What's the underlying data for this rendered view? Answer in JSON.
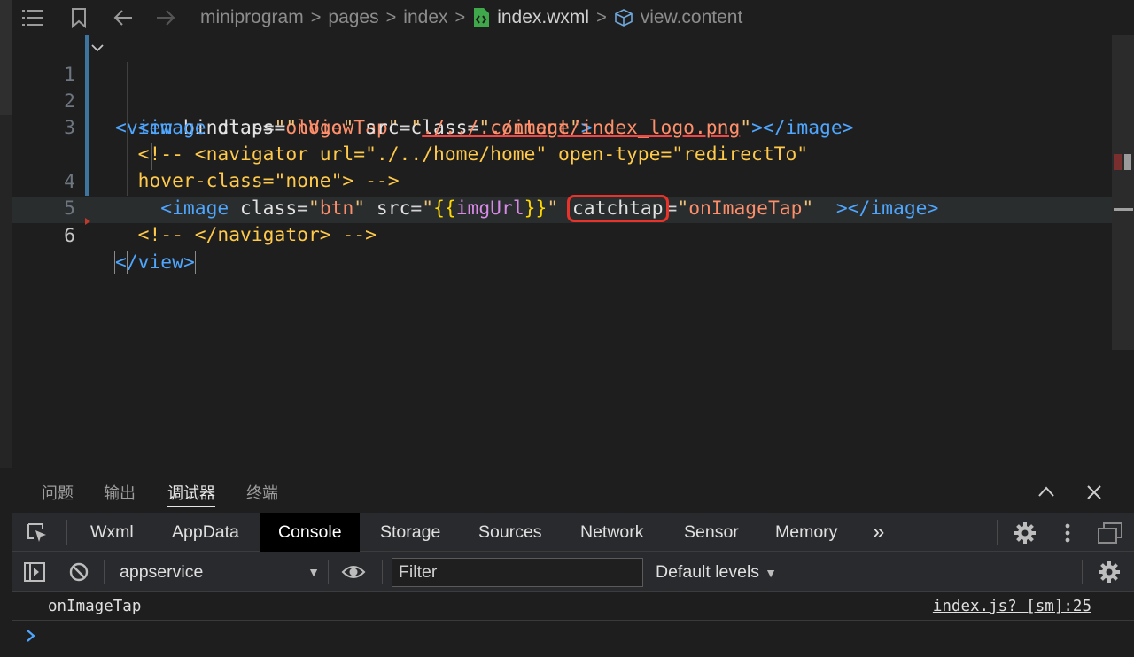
{
  "header": {
    "breadcrumbs": [
      "miniprogram",
      "pages",
      "index",
      "index.wxml",
      "view.content"
    ],
    "sep": ">"
  },
  "editor": {
    "line_numbers": [
      "1",
      "2",
      "3",
      "",
      "4",
      "5",
      "6"
    ],
    "lines": {
      "l1": [
        {
          "c": "t-tag",
          "t": "<view"
        },
        {
          "c": "t-attr",
          "t": " bindtap"
        },
        {
          "c": "t-eq",
          "t": "="
        },
        {
          "c": "t-str",
          "t": "\""
        },
        {
          "c": "t-val",
          "t": "onViewTap"
        },
        {
          "c": "t-str",
          "t": "\""
        },
        {
          "c": "t-attr",
          "t": " class"
        },
        {
          "c": "t-eq",
          "t": "="
        },
        {
          "c": "t-str",
          "t": "\""
        },
        {
          "c": "t-val",
          "t": "content"
        },
        {
          "c": "t-str",
          "t": "\""
        },
        {
          "c": "t-tag",
          "t": ">"
        }
      ],
      "l2": [
        {
          "c": "t-tag",
          "t": "  <image"
        },
        {
          "c": "t-attr",
          "t": " class"
        },
        {
          "c": "t-eq",
          "t": "="
        },
        {
          "c": "t-str",
          "t": "\""
        },
        {
          "c": "t-val",
          "t": "logo"
        },
        {
          "c": "t-str",
          "t": "\""
        },
        {
          "c": "t-attr",
          "t": " src"
        },
        {
          "c": "t-eq",
          "t": "="
        },
        {
          "c": "t-str",
          "t": "\""
        },
        {
          "c": "t-path",
          "t": "./../../image/index_logo.png"
        },
        {
          "c": "t-str",
          "t": "\""
        },
        {
          "c": "t-tag",
          "t": "></image>"
        }
      ],
      "l3a": [
        {
          "c": "t-com",
          "t": "  <!-- <navigator url=\"./../home/home\" open-type=\"redirectTo\""
        }
      ],
      "l3b": [
        {
          "c": "t-com",
          "t": "  hover-class=\"none\"> -->"
        }
      ],
      "l4": [
        {
          "c": "t-tag",
          "t": "    <image"
        },
        {
          "c": "t-attr",
          "t": " class"
        },
        {
          "c": "t-eq",
          "t": "="
        },
        {
          "c": "t-str",
          "t": "\""
        },
        {
          "c": "t-val",
          "t": "btn"
        },
        {
          "c": "t-str",
          "t": "\""
        },
        {
          "c": "t-attr",
          "t": " src"
        },
        {
          "c": "t-eq",
          "t": "="
        },
        {
          "c": "t-str",
          "t": "\""
        },
        {
          "c": "t-br",
          "t": "{{"
        },
        {
          "c": "t-var",
          "t": "imgUrl"
        },
        {
          "c": "t-br",
          "t": "}}"
        },
        {
          "c": "t-str",
          "t": "\""
        },
        {
          "c": "t-attr",
          "t": " "
        },
        {
          "c": "t-attr hl-box",
          "t": "catchtap"
        },
        {
          "c": "t-eq",
          "t": "="
        },
        {
          "c": "t-str",
          "t": "\""
        },
        {
          "c": "t-val",
          "t": "onImageTap"
        },
        {
          "c": "t-str",
          "t": "\""
        },
        {
          "c": "t-tag",
          "t": "  ></image>"
        }
      ],
      "l5": [
        {
          "c": "t-com",
          "t": "  <!-- </navigator> -->"
        }
      ],
      "l6": [
        {
          "c": "t-tag bracket-match",
          "t": "<"
        },
        {
          "c": "t-tag",
          "t": "/view"
        },
        {
          "c": "t-tag bracket-match",
          "t": ">"
        }
      ]
    }
  },
  "panel": {
    "tabs": [
      "问题",
      "输出",
      "调试器",
      "终端"
    ],
    "active_tab": "调试器"
  },
  "devtools": {
    "tabs": [
      "Wxml",
      "AppData",
      "Console",
      "Storage",
      "Sources",
      "Network",
      "Sensor",
      "Memory"
    ],
    "active_tab": "Console",
    "more": "»"
  },
  "console": {
    "context": "appservice",
    "filter_placeholder": "Filter",
    "levels": "Default levels",
    "caret": "▼",
    "log": {
      "message": "onImageTap",
      "source": "index.js? [sm]:25"
    }
  },
  "colors": {
    "accent_highlight": "#e8322a",
    "tag": "#4fa6ff",
    "string_value": "#ff8f6b",
    "comment": "#ffc94a"
  },
  "icons": [
    "menu-icon",
    "bookmark-icon",
    "back-arrow-icon",
    "forward-arrow-icon",
    "wxml-file-icon",
    "cube-icon",
    "fold-chevron-icon",
    "chevron-up-icon",
    "close-icon",
    "inspect-icon",
    "more-tabs-icon",
    "gear-icon",
    "kebab-icon",
    "dock-icon",
    "sidebar-toggle-icon",
    "clear-console-icon",
    "eye-icon",
    "prompt-chevron-icon"
  ]
}
